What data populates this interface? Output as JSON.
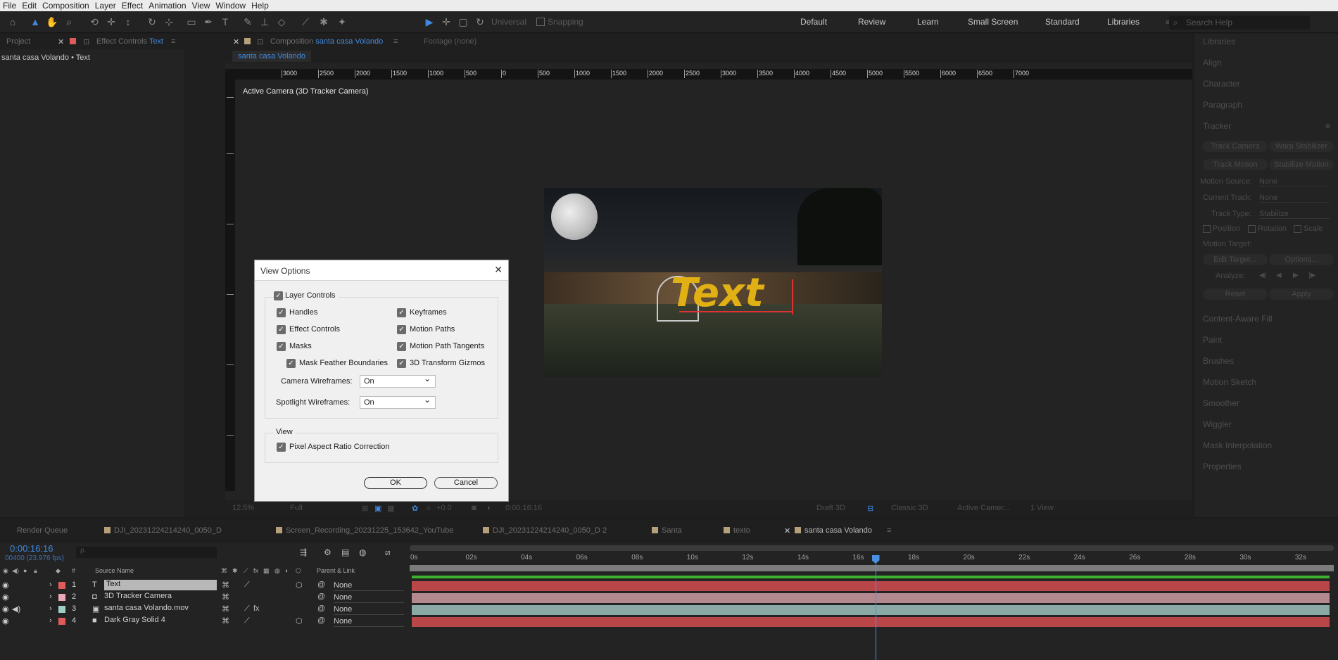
{
  "menu": [
    "File",
    "Edit",
    "Composition",
    "Layer",
    "Effect",
    "Animation",
    "View",
    "Window",
    "Help"
  ],
  "toolbar": {
    "universal_label": "Universal",
    "snapping_label": "Snapping",
    "workspaces": [
      "Default",
      "Review",
      "Learn",
      "Small Screen",
      "Standard",
      "Libraries"
    ],
    "overflow": "»",
    "search_placeholder": "Search Help"
  },
  "left_panel": {
    "tab_project": "Project",
    "tab_effect_controls_prefix": "Effect Controls",
    "tab_effect_controls_layer": "Text",
    "breadcrumb": "santa casa Volando • Text"
  },
  "composition_panel": {
    "tab_prefix": "Composition",
    "tab_comp": "santa casa Volando",
    "tab_footage": "Footage (none)",
    "subtab": "santa casa Volando",
    "ruler_labels": [
      "3000",
      "2500",
      "2000",
      "1500",
      "1000",
      "500",
      "0",
      "500",
      "1000",
      "1500",
      "2000",
      "2500",
      "3000",
      "3500",
      "4000",
      "4500",
      "5000",
      "5500",
      "6000",
      "6500",
      "7000"
    ],
    "camera_label": "Active Camera (3D Tracker Camera)",
    "footer": {
      "zoom": "12.5%",
      "resolution": "Full",
      "exposure": "+0.0",
      "timecode": "0:00:16:16",
      "renderer": "Draft 3D",
      "classic": "Classic 3D",
      "camera": "Active Camer...",
      "views": "1 View"
    },
    "preview_text": "Text"
  },
  "right_panel": {
    "sections": [
      "Libraries",
      "Align",
      "Character",
      "Paragraph",
      "Tracker"
    ],
    "tracker": {
      "buttons_row1": [
        "Track Camera",
        "Warp Stabilizer"
      ],
      "buttons_row2": [
        "Track Motion",
        "Stabilize Motion"
      ],
      "motion_source_label": "Motion Source:",
      "motion_source_value": "None",
      "current_track_label": "Current Track:",
      "current_track_value": "None",
      "track_type_label": "Track Type:",
      "track_type_value": "Stabilize",
      "position_label": "Position",
      "rotation_label": "Rotation",
      "scale_label": "Scale",
      "motion_target_label": "Motion Target:",
      "edit_target": "Edit Target...",
      "options": "Options...",
      "analyze_label": "Analyze:",
      "reset": "Reset",
      "apply": "Apply"
    },
    "sections_after": [
      "Content-Aware Fill",
      "Paint",
      "Brushes",
      "Motion Sketch",
      "Smoother",
      "Wiggler",
      "Mask Interpolation",
      "Properties"
    ]
  },
  "dialog": {
    "title": "View Options",
    "layer_controls": "Layer Controls",
    "left_col": [
      "Handles",
      "Effect Controls",
      "Masks"
    ],
    "mask_feather": "Mask Feather Boundaries",
    "right_col": [
      "Keyframes",
      "Motion Paths",
      "Motion Path Tangents",
      "3D Transform Gizmos"
    ],
    "camera_wireframes_label": "Camera Wireframes:",
    "camera_wireframes_value": "On",
    "spotlight_wireframes_label": "Spotlight Wireframes:",
    "spotlight_wireframes_value": "On",
    "view_group": "View",
    "pixel_aspect": "Pixel Aspect Ratio Correction",
    "ok": "OK",
    "cancel": "Cancel"
  },
  "timeline": {
    "tabs": [
      {
        "label": "Render Queue",
        "color": ""
      },
      {
        "label": "DJI_20231224214240_0050_D",
        "color": "#b5a07a"
      },
      {
        "label": "Screen_Recording_20231225_153642_YouTube",
        "color": "#b5a07a"
      },
      {
        "label": "DJI_20231224214240_0050_D 2",
        "color": "#b5a07a"
      },
      {
        "label": "Santa",
        "color": "#b5a07a"
      },
      {
        "label": "texto",
        "color": "#b5a07a"
      },
      {
        "label": "santa casa Volando",
        "color": "#b5a07a"
      }
    ],
    "timecode": "0:00:16:16",
    "frames": "00400 (23.976 fps)",
    "search_placeholder": "ρ.",
    "col_hash": "#",
    "col_source": "Source Name",
    "col_parent": "Parent & Link",
    "ruler": [
      "0s",
      "02s",
      "04s",
      "06s",
      "08s",
      "10s",
      "12s",
      "14s",
      "16s",
      "18s",
      "20s",
      "22s",
      "24s",
      "26s",
      "28s",
      "30s",
      "32s"
    ],
    "playhead_fraction": 0.505,
    "layers": [
      {
        "num": "1",
        "name": "Text",
        "type": "T",
        "label_color": "#e05a5a",
        "parent": "None",
        "bar_color": "#b9474a"
      },
      {
        "num": "2",
        "name": "3D Tracker Camera",
        "type": "cam",
        "label_color": "#e8a9b5",
        "parent": "None",
        "bar_color": "#b3898f"
      },
      {
        "num": "3",
        "name": "santa casa Volando.mov",
        "type": "mov",
        "label_color": "#9ecfc6",
        "parent": "None",
        "bar_color": "#8aa8a4"
      },
      {
        "num": "4",
        "name": "Dark Gray Solid 4",
        "type": "solid",
        "label_color": "#e05a5a",
        "parent": "None",
        "bar_color": "#b9474a"
      }
    ]
  }
}
